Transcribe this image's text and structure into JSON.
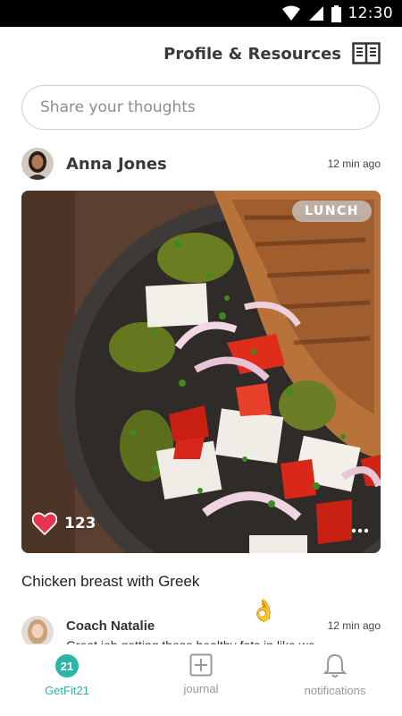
{
  "status_bar": {
    "time": "12:30"
  },
  "header": {
    "title": "Profile & Resources",
    "icon": "book-icon"
  },
  "share": {
    "placeholder": "Share your thoughts"
  },
  "post": {
    "author": "Anna Jones",
    "time": "12 min ago",
    "tag": "LUNCH",
    "likes": "123",
    "caption": "Chicken breast with Greek"
  },
  "comment": {
    "author": "Coach Natalie",
    "time": "12 min ago",
    "text": "Great job getting those healthy fats in like we",
    "emoji": "👌"
  },
  "bottom_nav": {
    "items": [
      {
        "label": "GetFit21",
        "icon": "getfit21-logo-icon",
        "active": true
      },
      {
        "label": "journal",
        "icon": "plus-square-icon",
        "active": false
      },
      {
        "label": "notifications",
        "icon": "bell-icon",
        "active": false
      }
    ]
  },
  "colors": {
    "accent": "#2bb5a6",
    "heart": "#e8334f"
  }
}
